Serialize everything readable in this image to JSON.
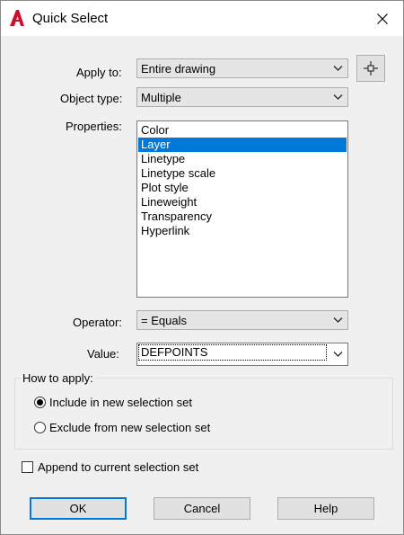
{
  "window": {
    "title": "Quick Select"
  },
  "form": {
    "apply_to": {
      "label": "Apply to:",
      "value": "Entire drawing"
    },
    "object_type": {
      "label": "Object type:",
      "value": "Multiple"
    },
    "properties": {
      "label": "Properties:",
      "items": [
        "Color",
        "Layer",
        "Linetype",
        "Linetype scale",
        "Plot style",
        "Lineweight",
        "Transparency",
        "Hyperlink"
      ],
      "selected": "Layer"
    },
    "operator": {
      "label": "Operator:",
      "value": "= Equals"
    },
    "value": {
      "label": "Value:",
      "value": "DEFPOINTS"
    }
  },
  "how_to_apply": {
    "title": "How to apply:",
    "include_label": "Include in new selection set",
    "exclude_label": "Exclude from new selection set",
    "selected": "include"
  },
  "append": {
    "label": "Append to current selection set",
    "checked": false
  },
  "buttons": {
    "ok": "OK",
    "cancel": "Cancel",
    "help": "Help"
  },
  "colors": {
    "accent": "#0078d7",
    "app_icon": "#c8102e"
  },
  "icons": {
    "app": "autocad-logo-icon",
    "close": "close-icon",
    "pick": "pick-objects-crosshair-icon",
    "dropdown": "chevron-down-icon"
  }
}
